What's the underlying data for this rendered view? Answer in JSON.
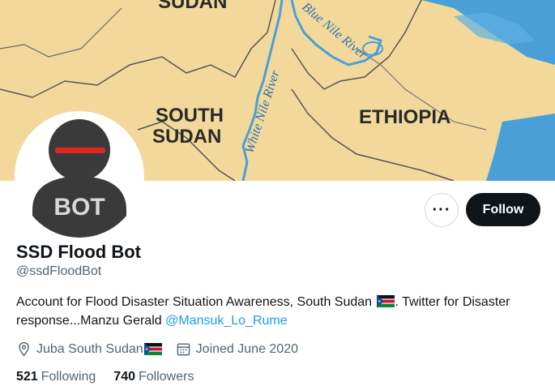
{
  "banner": {
    "labels": {
      "sudan": "SUDAN",
      "south_sudan_line1": "SOUTH",
      "south_sudan_line2": "SUDAN",
      "ethiopia": "ETHIOPIA",
      "white_nile": "White Nile River",
      "blue_nile": "Blue Nile River"
    },
    "colors": {
      "land": "#f2d99b",
      "water": "#4a9fd8",
      "border": "#555555"
    }
  },
  "avatar": {
    "text": "BOT",
    "colors": {
      "body": "#3a3a3a",
      "band": "#e0271f"
    }
  },
  "actions": {
    "more_label": "···",
    "follow_label": "Follow"
  },
  "profile": {
    "name": "SSD Flood Bot",
    "handle": "@ssdFloodBot",
    "bio_part1": "Account for Flood Disaster Situation Awareness, South Sudan",
    "bio_part2": ". Twitter for Disaster response...Manzu Gerald ",
    "bio_mention": "@Mansuk_Lo_Rume",
    "location": "Juba South Sudan",
    "joined": "Joined June 2020"
  },
  "stats": {
    "following_count": "521",
    "following_label": "Following",
    "followers_count": "740",
    "followers_label": "Followers"
  },
  "icons": {
    "location": "location-pin-icon",
    "calendar": "calendar-icon",
    "flag": "south-sudan-flag-icon"
  }
}
